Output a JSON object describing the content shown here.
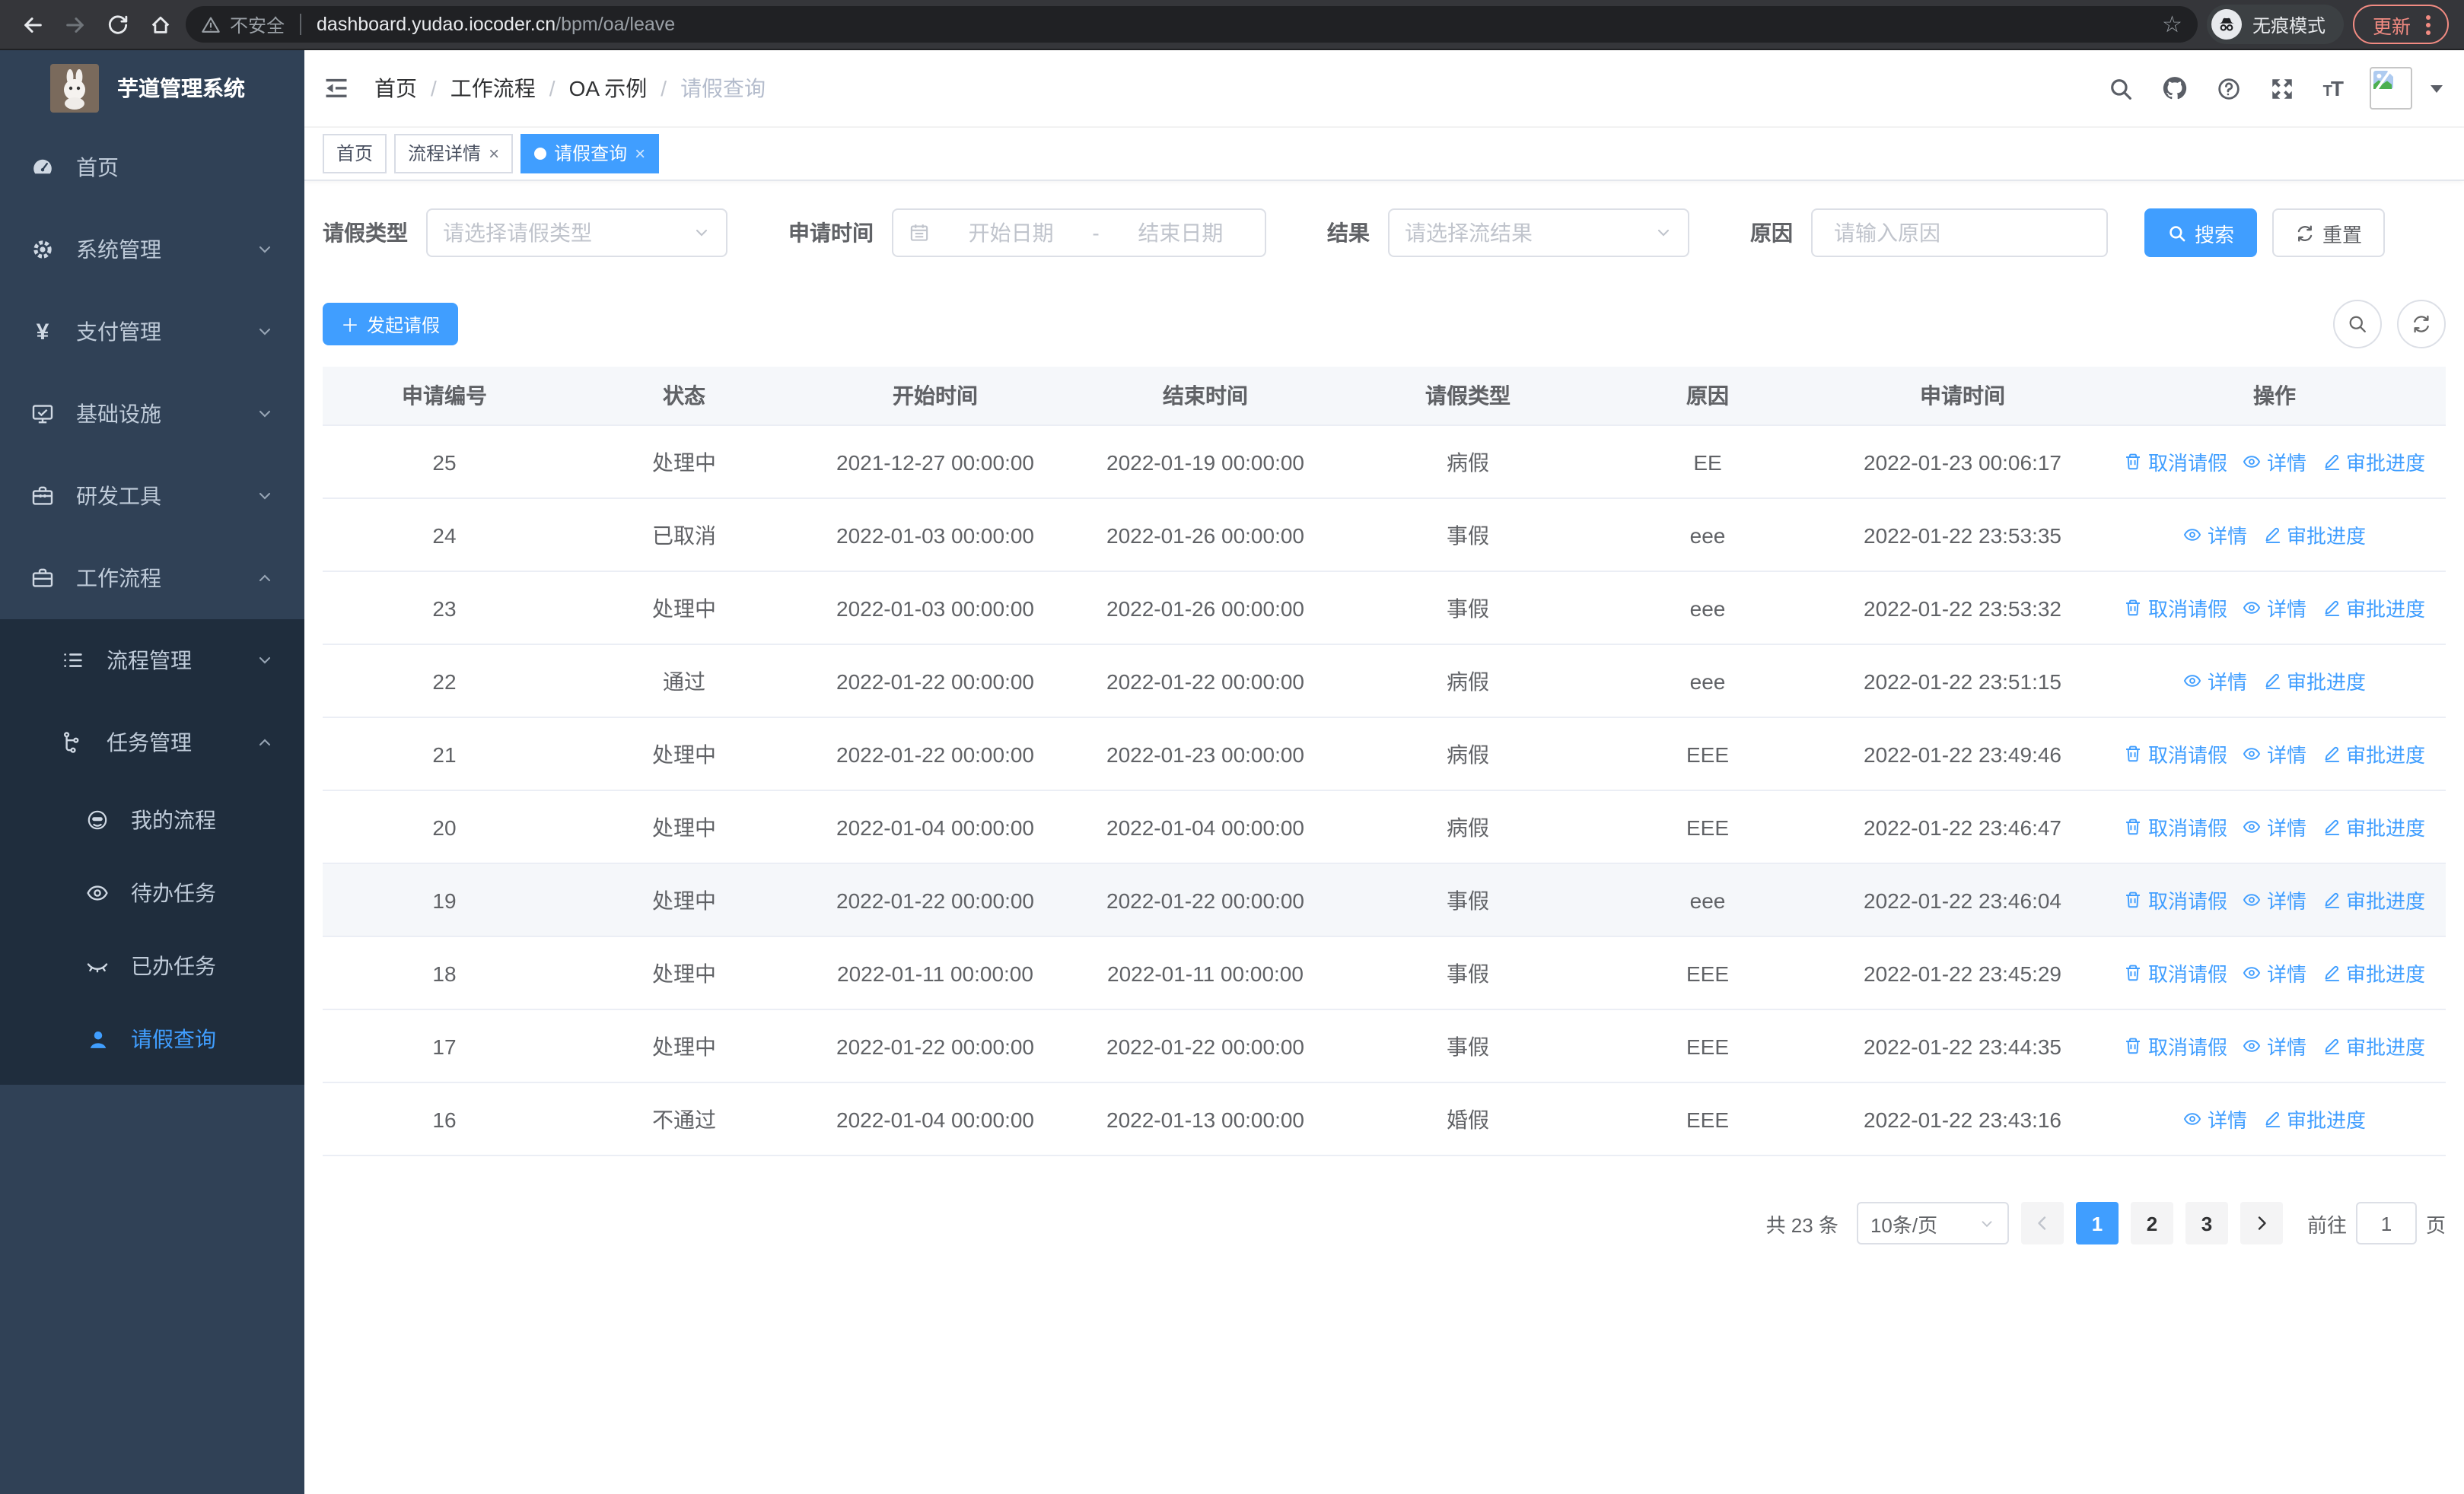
{
  "browser": {
    "security_label": "不安全",
    "url_host": "dashboard.yudao.iocoder.cn",
    "url_path": "/bpm/oa/leave",
    "incognito_label": "无痕模式",
    "update_label": "更新"
  },
  "colors": {
    "primary": "#409eff",
    "sidebar_bg": "#304156",
    "submenu_bg": "#1f2d3d",
    "update_accent": "#f28b82"
  },
  "sidebar": {
    "app_title": "芋道管理系统",
    "menu": [
      {
        "label": "首页",
        "icon": "dashboard-icon",
        "level": 1
      },
      {
        "label": "系统管理",
        "icon": "gear-icon",
        "level": 1,
        "chevron": "down"
      },
      {
        "label": "支付管理",
        "icon": "yen-icon",
        "level": 1,
        "chevron": "down"
      },
      {
        "label": "基础设施",
        "icon": "monitor-icon",
        "level": 1,
        "chevron": "down"
      },
      {
        "label": "研发工具",
        "icon": "toolbox-icon",
        "level": 1,
        "chevron": "down"
      },
      {
        "label": "工作流程",
        "icon": "briefcase-icon",
        "level": 1,
        "chevron": "up"
      },
      {
        "label": "流程管理",
        "icon": "list-icon",
        "level": 2,
        "chevron": "down",
        "sub": true
      },
      {
        "label": "任务管理",
        "icon": "tree-icon",
        "level": 2,
        "chevron": "up",
        "sub": true
      },
      {
        "label": "我的流程",
        "icon": "robot-icon",
        "level": 3,
        "sub": true
      },
      {
        "label": "待办任务",
        "icon": "eye-icon",
        "level": 3,
        "sub": true
      },
      {
        "label": "已办任务",
        "icon": "eye-closed-icon",
        "level": 3,
        "sub": true
      },
      {
        "label": "请假查询",
        "icon": "user-icon",
        "level": 3,
        "sub": true,
        "active": true
      }
    ]
  },
  "navbar": {
    "breadcrumb": [
      {
        "label": "首页"
      },
      {
        "label": "工作流程"
      },
      {
        "label": "OA 示例"
      },
      {
        "label": "请假查询",
        "current": true
      }
    ]
  },
  "tabs": [
    {
      "label": "首页",
      "closable": false,
      "active": false
    },
    {
      "label": "流程详情",
      "closable": true,
      "active": false
    },
    {
      "label": "请假查询",
      "closable": true,
      "active": true
    }
  ],
  "filters": {
    "type_label": "请假类型",
    "type_placeholder": "请选择请假类型",
    "time_label": "申请时间",
    "start_placeholder": "开始日期",
    "range_separator": "-",
    "end_placeholder": "结束日期",
    "result_label": "结果",
    "result_placeholder": "请选择流结果",
    "reason_label": "原因",
    "reason_placeholder": "请输入原因",
    "search_label": "搜索",
    "reset_label": "重置"
  },
  "toolbar": {
    "create_label": "发起请假"
  },
  "table": {
    "headers": [
      "申请编号",
      "状态",
      "开始时间",
      "结束时间",
      "请假类型",
      "原因",
      "申请时间",
      "操作"
    ],
    "action_labels": {
      "cancel": "取消请假",
      "detail": "详情",
      "progress": "审批进度"
    },
    "rows": [
      {
        "id": "25",
        "status": "处理中",
        "start": "2021-12-27 00:00:00",
        "end": "2022-01-19 00:00:00",
        "type": "病假",
        "reason": "EE",
        "applied": "2022-01-23 00:06:17",
        "actions": [
          "cancel",
          "detail",
          "progress"
        ],
        "highlighted": false
      },
      {
        "id": "24",
        "status": "已取消",
        "start": "2022-01-03 00:00:00",
        "end": "2022-01-26 00:00:00",
        "type": "事假",
        "reason": "eee",
        "applied": "2022-01-22 23:53:35",
        "actions": [
          "detail",
          "progress"
        ],
        "highlighted": false
      },
      {
        "id": "23",
        "status": "处理中",
        "start": "2022-01-03 00:00:00",
        "end": "2022-01-26 00:00:00",
        "type": "事假",
        "reason": "eee",
        "applied": "2022-01-22 23:53:32",
        "actions": [
          "cancel",
          "detail",
          "progress"
        ],
        "highlighted": false
      },
      {
        "id": "22",
        "status": "通过",
        "start": "2022-01-22 00:00:00",
        "end": "2022-01-22 00:00:00",
        "type": "病假",
        "reason": "eee",
        "applied": "2022-01-22 23:51:15",
        "actions": [
          "detail",
          "progress"
        ],
        "highlighted": false
      },
      {
        "id": "21",
        "status": "处理中",
        "start": "2022-01-22 00:00:00",
        "end": "2022-01-23 00:00:00",
        "type": "病假",
        "reason": "EEE",
        "applied": "2022-01-22 23:49:46",
        "actions": [
          "cancel",
          "detail",
          "progress"
        ],
        "highlighted": false
      },
      {
        "id": "20",
        "status": "处理中",
        "start": "2022-01-04 00:00:00",
        "end": "2022-01-04 00:00:00",
        "type": "病假",
        "reason": "EEE",
        "applied": "2022-01-22 23:46:47",
        "actions": [
          "cancel",
          "detail",
          "progress"
        ],
        "highlighted": false
      },
      {
        "id": "19",
        "status": "处理中",
        "start": "2022-01-22 00:00:00",
        "end": "2022-01-22 00:00:00",
        "type": "事假",
        "reason": "eee",
        "applied": "2022-01-22 23:46:04",
        "actions": [
          "cancel",
          "detail",
          "progress"
        ],
        "highlighted": true
      },
      {
        "id": "18",
        "status": "处理中",
        "start": "2022-01-11 00:00:00",
        "end": "2022-01-11 00:00:00",
        "type": "事假",
        "reason": "EEE",
        "applied": "2022-01-22 23:45:29",
        "actions": [
          "cancel",
          "detail",
          "progress"
        ],
        "highlighted": false
      },
      {
        "id": "17",
        "status": "处理中",
        "start": "2022-01-22 00:00:00",
        "end": "2022-01-22 00:00:00",
        "type": "事假",
        "reason": "EEE",
        "applied": "2022-01-22 23:44:35",
        "actions": [
          "cancel",
          "detail",
          "progress"
        ],
        "highlighted": false
      },
      {
        "id": "16",
        "status": "不通过",
        "start": "2022-01-04 00:00:00",
        "end": "2022-01-13 00:00:00",
        "type": "婚假",
        "reason": "EEE",
        "applied": "2022-01-22 23:43:16",
        "actions": [
          "detail",
          "progress"
        ],
        "highlighted": false
      }
    ]
  },
  "pagination": {
    "total_label": "共 23 条",
    "page_size": "10条/页",
    "pages": [
      {
        "label": "1",
        "active": true
      },
      {
        "label": "2",
        "active": false
      },
      {
        "label": "3",
        "active": false
      }
    ],
    "goto_label": "前往",
    "goto_value": "1",
    "page_suffix": "页"
  }
}
